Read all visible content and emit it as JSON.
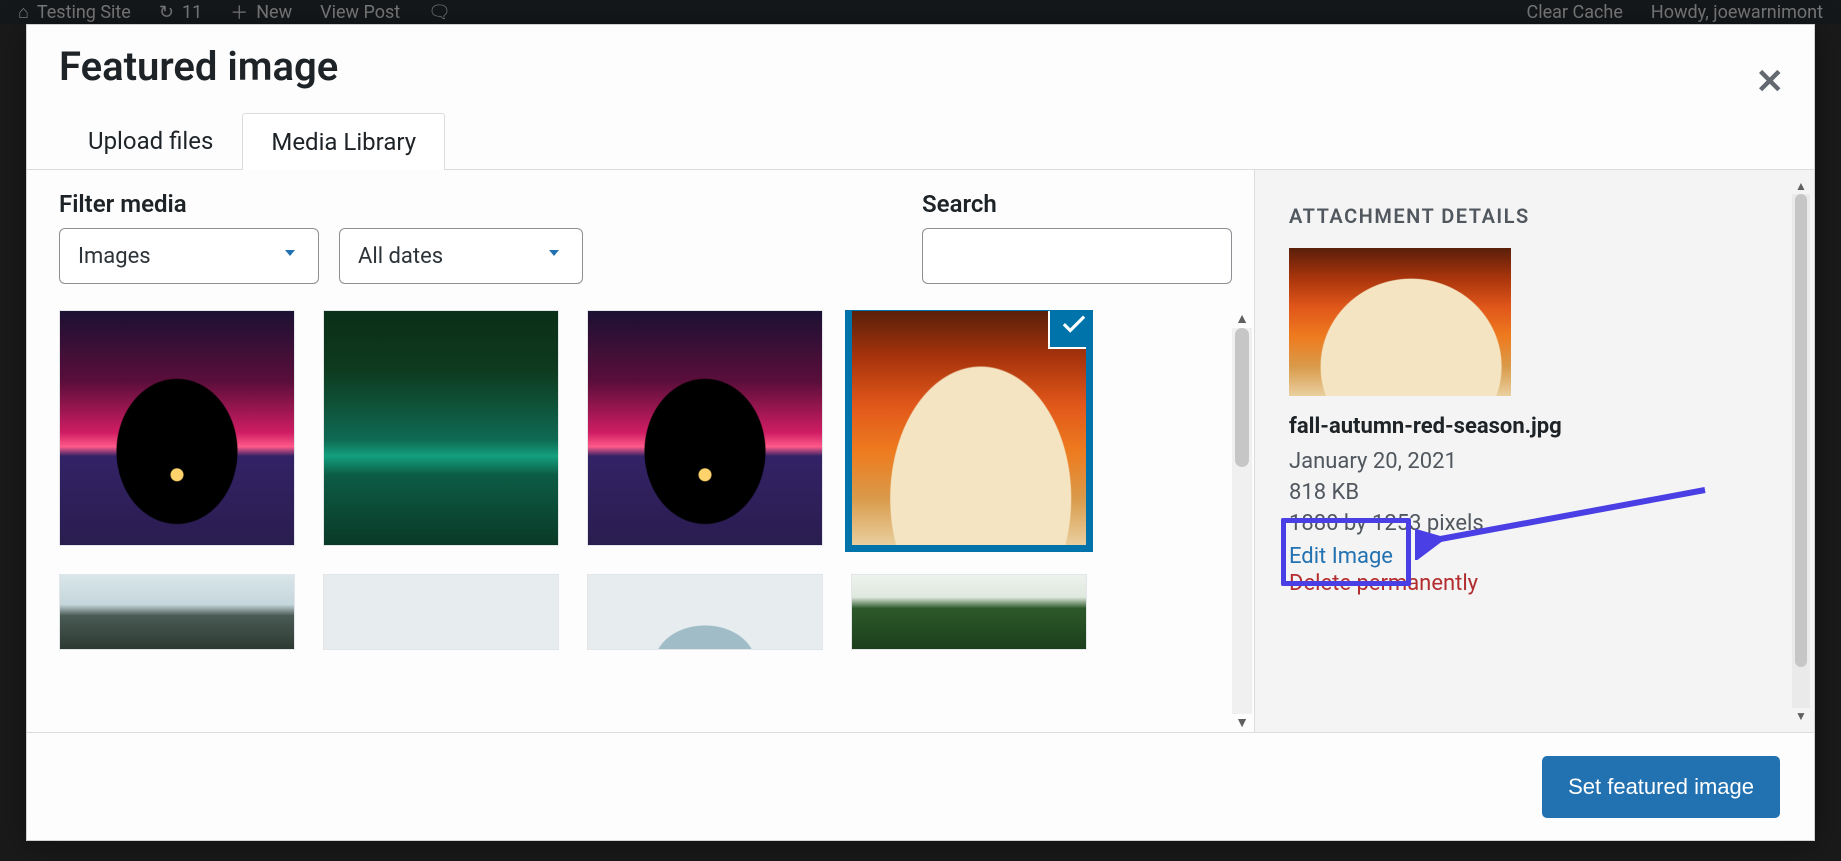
{
  "adminbar": {
    "left": [
      "Testing Site",
      "11",
      "New",
      "View Post"
    ],
    "right": [
      "Clear Cache",
      "Howdy, joewarnimont"
    ]
  },
  "modal": {
    "title": "Featured image",
    "tabs": {
      "upload": "Upload files",
      "library": "Media Library"
    },
    "active_tab": "library"
  },
  "filters": {
    "label": "Filter media",
    "type_select": "Images",
    "date_select": "All dates"
  },
  "search": {
    "label": "Search",
    "value": ""
  },
  "grid": {
    "items": [
      {
        "name": "sunset-tree-1",
        "class": "img-sunset",
        "selected": false
      },
      {
        "name": "jungle-stream",
        "class": "img-jungle",
        "selected": false
      },
      {
        "name": "sunset-tree-2",
        "class": "img-sunset",
        "selected": false
      },
      {
        "name": "fall-autumn",
        "class": "img-autumn",
        "selected": true
      }
    ],
    "items_row2": [
      {
        "name": "mountain",
        "class": "img-mountain"
      },
      {
        "name": "blank-1",
        "class": "img-blank"
      },
      {
        "name": "blank-2",
        "class": "img-blank2"
      },
      {
        "name": "pines",
        "class": "img-pines"
      }
    ]
  },
  "details": {
    "heading": "ATTACHMENT DETAILS",
    "filename": "fall-autumn-red-season.jpg",
    "date": "January 20, 2021",
    "size": "818 KB",
    "dimensions": "1880 by 1253 pixels",
    "edit_link": "Edit Image",
    "delete_link": "Delete permanently"
  },
  "footer": {
    "submit": "Set featured image"
  }
}
